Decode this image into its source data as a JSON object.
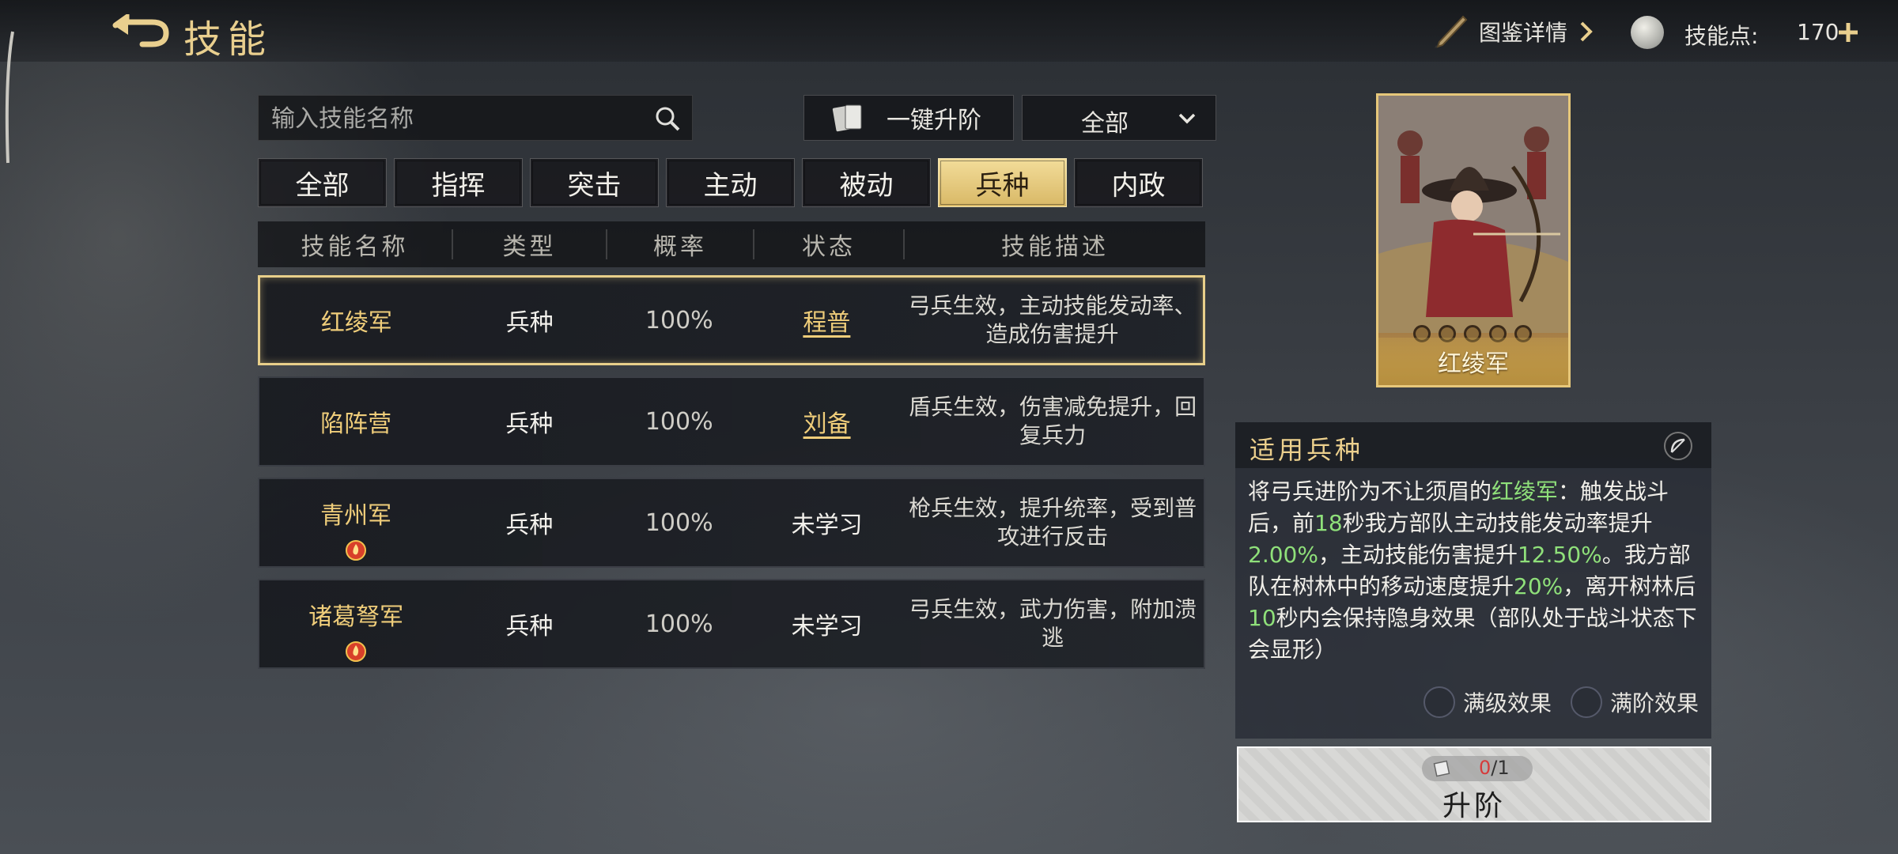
{
  "header": {
    "title": "技能",
    "codex_label": "图鉴详情",
    "skill_points_label": "技能点:",
    "skill_points_value": "170"
  },
  "search": {
    "placeholder": "输入技能名称"
  },
  "toolbar": {
    "upgrade_all_label": "一键升阶",
    "filter_selected": "全部"
  },
  "tabs": [
    {
      "label": "全部"
    },
    {
      "label": "指挥"
    },
    {
      "label": "突击"
    },
    {
      "label": "主动"
    },
    {
      "label": "被动"
    },
    {
      "label": "兵种",
      "active": true
    },
    {
      "label": "内政"
    }
  ],
  "table": {
    "headers": [
      "技能名称",
      "类型",
      "概率",
      "状态",
      "技能描述"
    ],
    "rows": [
      {
        "name": "红绫军",
        "type": "兵种",
        "rate": "100%",
        "state": "程普",
        "desc": "弓兵生效，主动技能发动率、造成伤害提升",
        "selected": true
      },
      {
        "name": "陷阵营",
        "type": "兵种",
        "rate": "100%",
        "state": "刘备",
        "desc": "盾兵生效，伤害减免提升，回复兵力"
      },
      {
        "name": "青州军",
        "type": "兵种",
        "rate": "100%",
        "state": "未学习",
        "desc": "枪兵生效，提升统率，受到普攻进行反击"
      },
      {
        "name": "诸葛弩军",
        "type": "兵种",
        "rate": "100%",
        "state": "未学习",
        "desc": "弓兵生效，武力伤害，附加溃逃"
      }
    ]
  },
  "card": {
    "name": "红绫军"
  },
  "detail": {
    "title": "适用兵种",
    "text": {
      "p1": "将弓兵进阶为不让须眉的",
      "hl1": "红绫军",
      "p2": "：触发战斗后，前",
      "hl2": "18",
      "p3": "秒我方部队主动技能发动率提升",
      "hl3": "2.00%",
      "p4": "，主动技能伤害提升",
      "hl4": "12.50%",
      "p5": "。我方部队在树林中的移动速度提升",
      "hl5": "20%",
      "p6": "，离开树林后",
      "hl6": "10",
      "p7": "秒内会保持隐身效果（部队处于战斗状态下会显形）"
    },
    "toggle_max_level": "满级效果",
    "toggle_max_rank": "满阶效果"
  },
  "upgrade": {
    "have": "0",
    "need": "/1",
    "label": "升阶"
  },
  "colors": {
    "accent_gold": "#efcd7a",
    "highlight_green": "#8fe07a",
    "active_tab": "#f3dd9a"
  }
}
